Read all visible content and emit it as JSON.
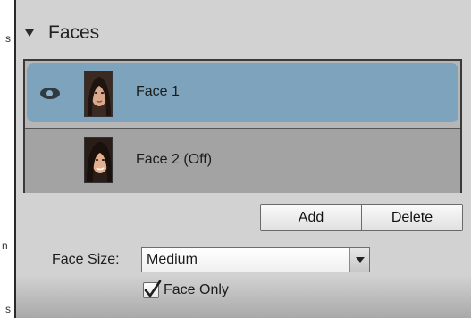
{
  "edge_fragments": [
    "s",
    "n",
    "s"
  ],
  "panel": {
    "title": "Faces",
    "expanded": true
  },
  "faces": [
    {
      "label": "Face 1",
      "visible": true,
      "selected": true
    },
    {
      "label": "Face 2 (Off)",
      "visible": false,
      "selected": false
    }
  ],
  "buttons": {
    "add": "Add",
    "delete": "Delete"
  },
  "face_size": {
    "label": "Face Size:",
    "value": "Medium"
  },
  "face_only": {
    "label": "Face Only",
    "checked": true
  },
  "icons": {
    "disclosure": "disclosure-triangle-down-icon",
    "visibility": "eye-icon",
    "select": "chevron-down-icon",
    "check": "checkmark-icon"
  },
  "colors": {
    "panel_bg": "#d2d2d2",
    "selected_row": "#7ea4bd",
    "list_bg": "#b6b6b6"
  }
}
